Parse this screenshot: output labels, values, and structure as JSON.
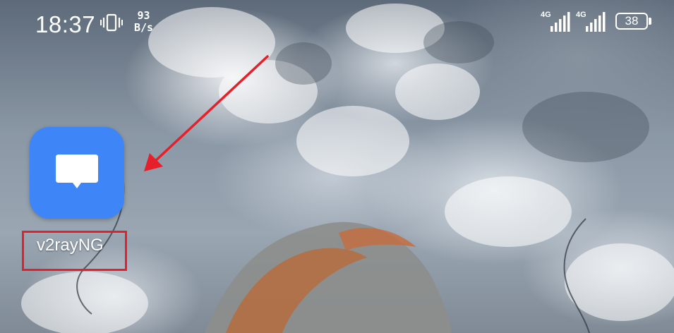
{
  "status_bar": {
    "time": "18:37",
    "net_speed_value": "93",
    "net_speed_unit": "B/s",
    "signal_1_tag": "4G",
    "signal_2_tag": "4G",
    "battery_level": "38"
  },
  "home_screen": {
    "apps": [
      {
        "label": "v2rayNG",
        "icon": "message-bubble-icon",
        "color": "#3e86f8"
      }
    ]
  },
  "annotations": {
    "highlight_color": "#e5202a",
    "arrow_color": "#e5202a"
  }
}
